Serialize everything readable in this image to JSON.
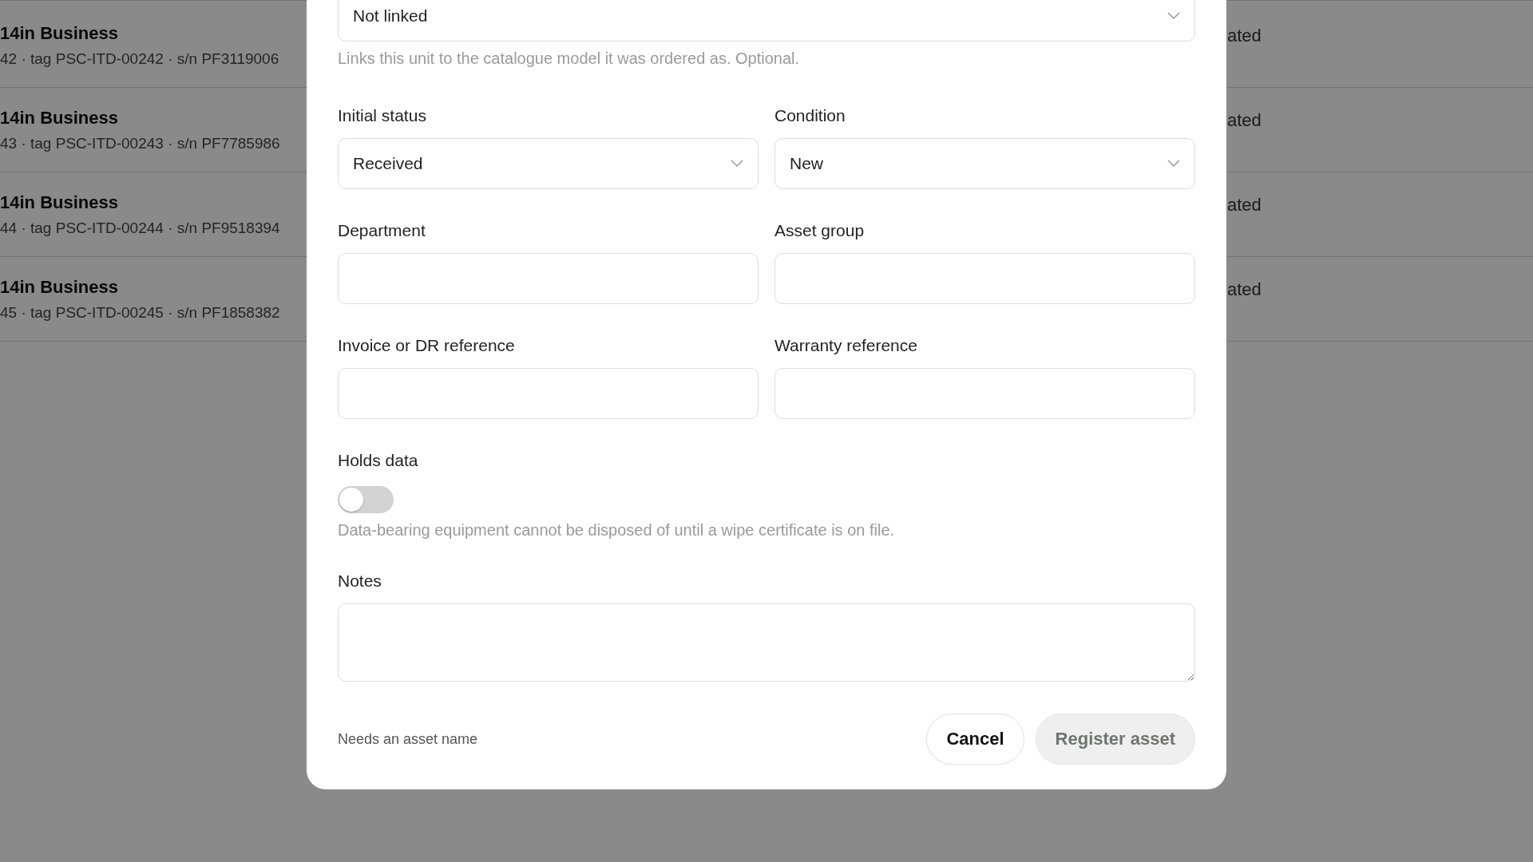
{
  "background_list": {
    "rows": [
      {
        "title": "14in Business",
        "subtitle": "42 · tag PSC-ITD-00242 · s/n PF3119006",
        "status": "ated"
      },
      {
        "title": "14in Business",
        "subtitle": "43 · tag PSC-ITD-00243 · s/n PF7785986",
        "status": "ated"
      },
      {
        "title": "14in Business",
        "subtitle": "44 · tag PSC-ITD-00244 · s/n PF9518394",
        "status": "ated"
      },
      {
        "title": "14in Business",
        "subtitle": "45 · tag PSC-ITD-00245 · s/n PF1858382",
        "status": "ated"
      }
    ]
  },
  "dialog": {
    "model_field": {
      "value": "Not linked",
      "hint": "Links this unit to the catalogue model it was ordered as. Optional."
    },
    "fields": [
      {
        "kind": "select",
        "label": "Initial status",
        "value": "Received"
      },
      {
        "kind": "select",
        "label": "Condition",
        "value": "New"
      },
      {
        "kind": "text",
        "label": "Department"
      },
      {
        "kind": "text",
        "label": "Asset group"
      },
      {
        "kind": "text",
        "label": "Invoice or DR reference"
      },
      {
        "kind": "text",
        "label": "Warranty reference"
      }
    ],
    "holds_data": {
      "label": "Holds data",
      "on": false,
      "hint": "Data-bearing equipment cannot be disposed of until a wipe certificate is on file."
    },
    "notes": {
      "label": "Notes"
    },
    "footer": {
      "message": "Needs an asset name",
      "buttons": [
        {
          "label": "Cancel",
          "kind": "secondary",
          "disabled": false
        },
        {
          "label": "Register asset",
          "kind": "primary",
          "disabled": true
        }
      ]
    }
  }
}
